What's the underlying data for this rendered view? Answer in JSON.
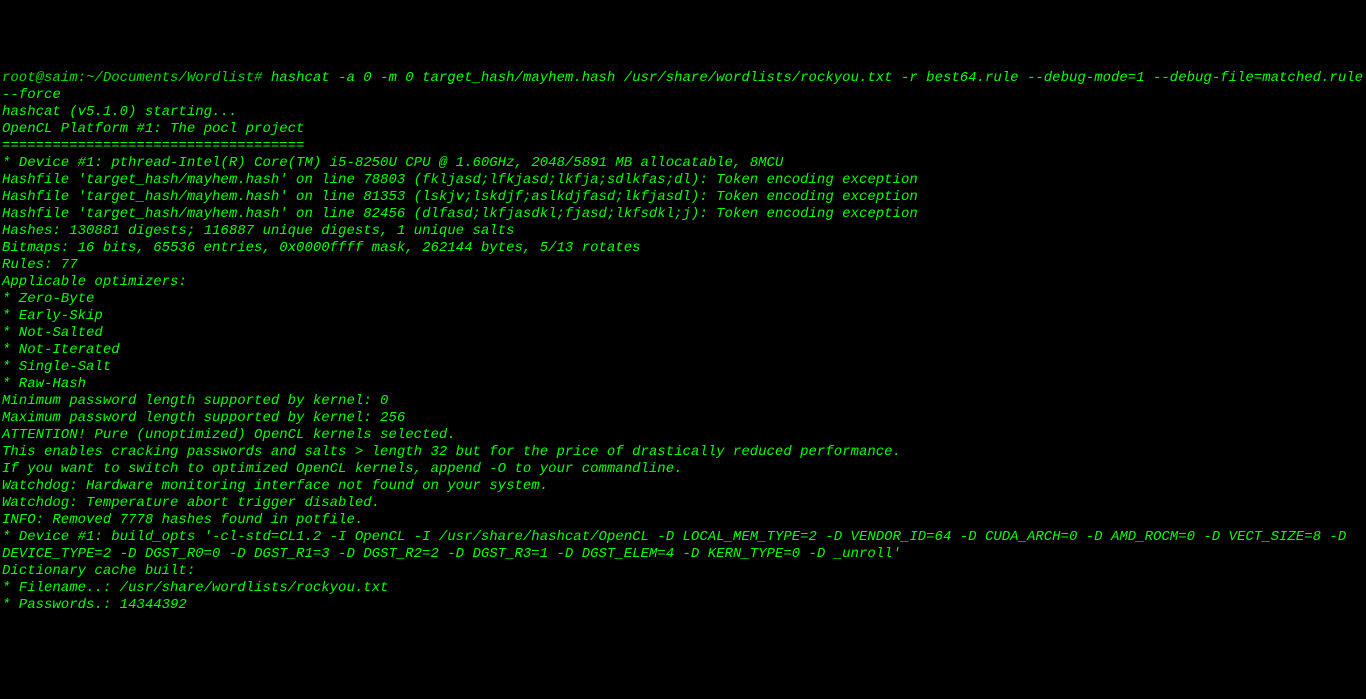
{
  "terminal": {
    "prompt": "root@saim:~/Documents/Wordlist#",
    "command": "hashcat -a 0 -m 0 target_hash/mayhem.hash /usr/share/wordlists/rockyou.txt -r best64.rule --debug-mode=1 --debug-file=matched.rule --force",
    "lines": [
      "hashcat (v5.1.0) starting...",
      "",
      "OpenCL Platform #1: The pocl project",
      "====================================",
      "* Device #1: pthread-Intel(R) Core(TM) i5-8250U CPU @ 1.60GHz, 2048/5891 MB allocatable, 8MCU",
      "",
      "Hashfile 'target_hash/mayhem.hash' on line 78803 (fkljasd;lfkjasd;lkfja;sdlkfas;dl): Token encoding exception",
      "Hashfile 'target_hash/mayhem.hash' on line 81353 (lskjv;lskdjf;aslkdjfasd;lkfjasdl): Token encoding exception",
      "Hashfile 'target_hash/mayhem.hash' on line 82456 (dlfasd;lkfjasdkl;fjasd;lkfsdkl;j): Token encoding exception",
      "Hashes: 130881 digests; 116887 unique digests, 1 unique salts",
      "Bitmaps: 16 bits, 65536 entries, 0x0000ffff mask, 262144 bytes, 5/13 rotates",
      "Rules: 77",
      "",
      "Applicable optimizers:",
      "* Zero-Byte",
      "* Early-Skip",
      "* Not-Salted",
      "* Not-Iterated",
      "* Single-Salt",
      "* Raw-Hash",
      "",
      "Minimum password length supported by kernel: 0",
      "Maximum password length supported by kernel: 256",
      "",
      "ATTENTION! Pure (unoptimized) OpenCL kernels selected.",
      "This enables cracking passwords and salts > length 32 but for the price of drastically reduced performance.",
      "If you want to switch to optimized OpenCL kernels, append -O to your commandline.",
      "",
      "Watchdog: Hardware monitoring interface not found on your system.",
      "Watchdog: Temperature abort trigger disabled.",
      "",
      "INFO: Removed 7778 hashes found in potfile.",
      "",
      "* Device #1: build_opts '-cl-std=CL1.2 -I OpenCL -I /usr/share/hashcat/OpenCL -D LOCAL_MEM_TYPE=2 -D VENDOR_ID=64 -D CUDA_ARCH=0 -D AMD_ROCM=0 -D VECT_SIZE=8 -D DEVICE_TYPE=2 -D DGST_R0=0 -D DGST_R1=3 -D DGST_R2=2 -D DGST_R3=1 -D DGST_ELEM=4 -D KERN_TYPE=0 -D _unroll'",
      "Dictionary cache built:",
      "* Filename..: /usr/share/wordlists/rockyou.txt",
      "* Passwords.: 14344392"
    ]
  }
}
